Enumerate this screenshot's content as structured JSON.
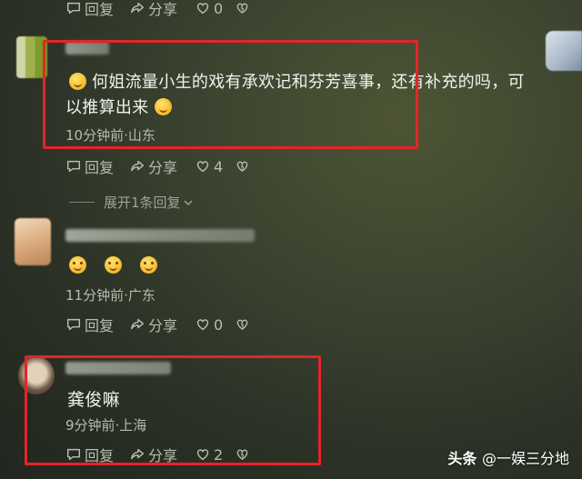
{
  "top_row": {
    "reply": "回复",
    "share": "分享",
    "likes": "0"
  },
  "comments": [
    {
      "text_line1": "何姐流量小生的戏有承欢记和芬芳喜事，还有补充的吗，可",
      "text_line2": "以推算出来",
      "meta": "10分钟前·山东",
      "reply": "回复",
      "share": "分享",
      "likes": "4",
      "expand": "展开1条回复"
    },
    {
      "meta": "11分钟前·广东",
      "reply": "回复",
      "share": "分享",
      "likes": "0"
    },
    {
      "text": "龚俊嘛",
      "meta": "9分钟前·上海",
      "reply": "回复",
      "share": "分享",
      "likes": "2"
    }
  ],
  "watermark": {
    "brand": "头条",
    "handle": "@一娱三分地"
  },
  "colors": {
    "highlight_box": "#e5242a",
    "background": "#2c3226"
  }
}
